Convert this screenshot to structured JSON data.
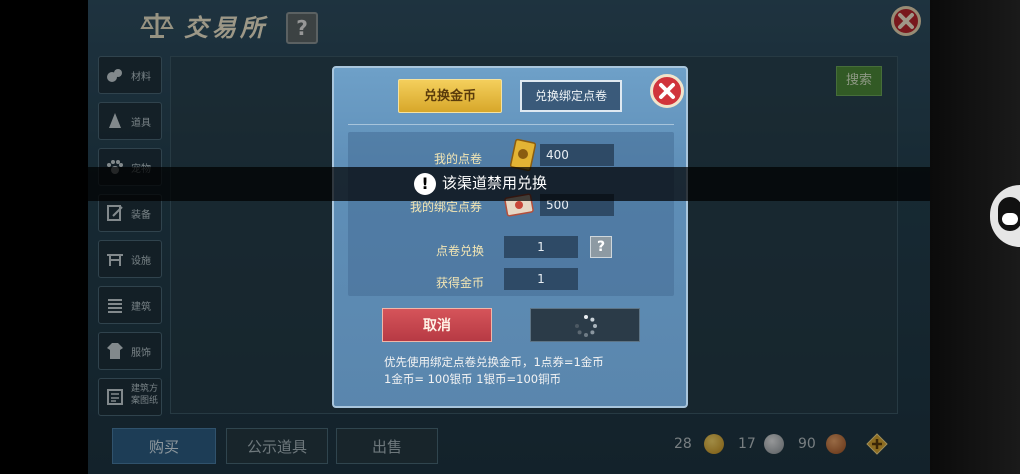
{
  "window": {
    "title": "交易所",
    "help_symbol": "?"
  },
  "sidebar": {
    "items": [
      {
        "label": "材料",
        "icon": "material-icon"
      },
      {
        "label": "道具",
        "icon": "tool-icon"
      },
      {
        "label": "宠物",
        "icon": "paw-icon"
      },
      {
        "label": "装备",
        "icon": "equipment-icon"
      },
      {
        "label": "设施",
        "icon": "facility-icon"
      },
      {
        "label": "建筑",
        "icon": "building-icon"
      },
      {
        "label": "服饰",
        "icon": "clothing-icon"
      },
      {
        "label": "建筑方案图纸",
        "icon": "blueprint-icon"
      }
    ]
  },
  "search": {
    "button_label": "搜索"
  },
  "bottom_tabs": [
    {
      "label": "购买",
      "active": true
    },
    {
      "label": "公示道具",
      "active": false
    },
    {
      "label": "出售",
      "active": false
    }
  ],
  "currencies": {
    "gold": "28",
    "silver": "17",
    "copper": "90"
  },
  "dialog": {
    "tab_gold": "兑换金币",
    "tab_bind": "兑换绑定点卷",
    "rows": {
      "points_label": "我的点卷",
      "points_value": "400",
      "bound_label": "我的绑定点券",
      "bound_value": "500",
      "exchange_label": "点卷兑换",
      "exchange_value": "1",
      "receive_label": "获得金币",
      "receive_value": "1"
    },
    "mini_help": "?",
    "cancel_label": "取消",
    "note_line1": "优先使用绑定点卷兑换金币，1点券=1金币",
    "note_line2": "1金币= 100银币  1银币=100铜币"
  },
  "toast": {
    "icon_text": "!",
    "message": "该渠道禁用兑换"
  },
  "colors": {
    "gold_button": "#e5ba3f",
    "cancel_button": "#c7474f",
    "close_red": "#d0343c",
    "search_green": "#4d8a3a"
  }
}
